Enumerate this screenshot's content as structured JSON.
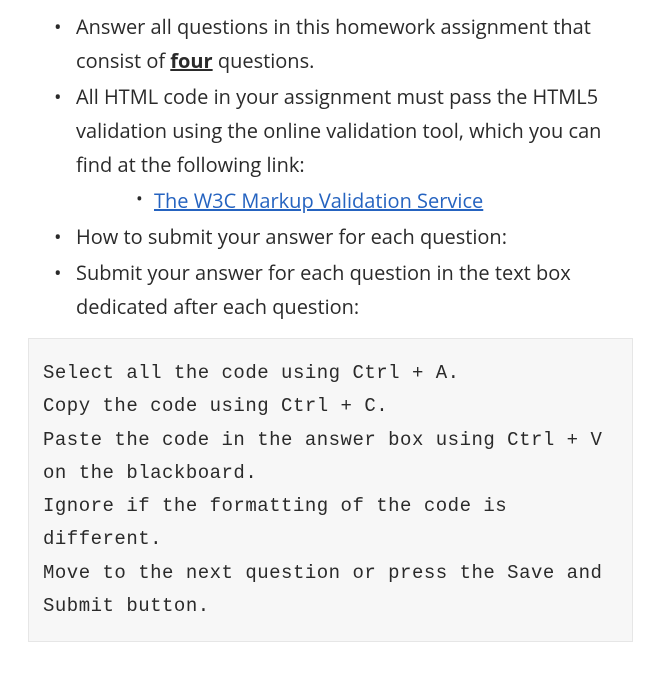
{
  "bullets": {
    "item1_pre": "Answer all questions in this homework assignment that consist of ",
    "item1_bold": "four",
    "item1_post": " questions.",
    "item2": "All HTML code in your assignment must pass the HTML5 validation using the online validation tool, which you can find at the following link:",
    "link_text": "The W3C Markup Validation Service",
    "item3": "How to submit your answer for each question:",
    "item4": "Submit your answer for each question in the text box dedicated after each question:"
  },
  "code_block": "Select all the code using Ctrl + A.\nCopy the code using Ctrl + C.\nPaste the code in the answer box using Ctrl + V on the blackboard.\nIgnore if the formatting of the code is different.\nMove to the next question or press the Save and Submit button."
}
